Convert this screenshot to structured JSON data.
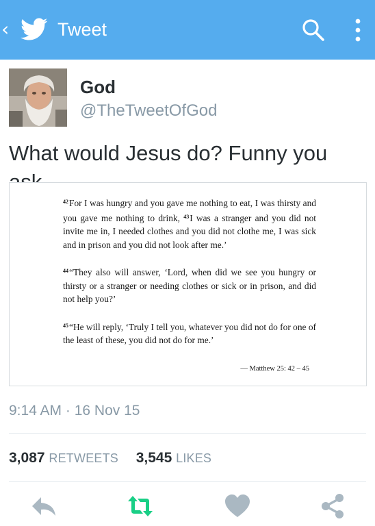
{
  "header": {
    "back_glyph": "‹",
    "title": "Tweet",
    "bird_icon": "twitter-bird-icon",
    "search_icon": "search-icon",
    "overflow_icon": "overflow-menu-icon",
    "bar_color": "#55acee"
  },
  "author": {
    "name": "God",
    "handle": "@TheTweetOfGod",
    "avatar_icon": "avatar"
  },
  "tweet": {
    "text": "What would Jesus do? Funny you ask."
  },
  "media": {
    "passages": [
      {
        "verse": "42",
        "text": "For I was hungry and you gave me nothing to eat, I was thirsty and you gave me nothing to drink,",
        "verse2": "43",
        "text2": "I was a stranger and you did not invite me in, I needed clothes and you did not clothe me, I was sick and in prison and you did not look after me.’"
      },
      {
        "verse": "44",
        "text": "“They also will answer, ‘Lord, when did we see you hungry or thirsty or a stranger or needing clothes or sick or in prison, and did not help you?’"
      },
      {
        "verse": "45",
        "text": "“He will reply, ‘Truly I tell you, whatever you did not do for one of the least of these, you did not do for me.’"
      }
    ],
    "citation": "— Matthew 25: 42 – 45"
  },
  "meta": {
    "timestamp": "9:14 AM · 16 Nov 15"
  },
  "stats": {
    "retweets_count": "3,087",
    "retweets_label": "RETWEETS",
    "likes_count": "3,545",
    "likes_label": "LIKES"
  },
  "actions": {
    "reply_icon": "reply-icon",
    "retweet_icon": "retweet-icon",
    "like_icon": "heart-icon",
    "share_icon": "share-icon",
    "icon_color": "#aab8c2",
    "retweet_color": "#19cf86"
  }
}
